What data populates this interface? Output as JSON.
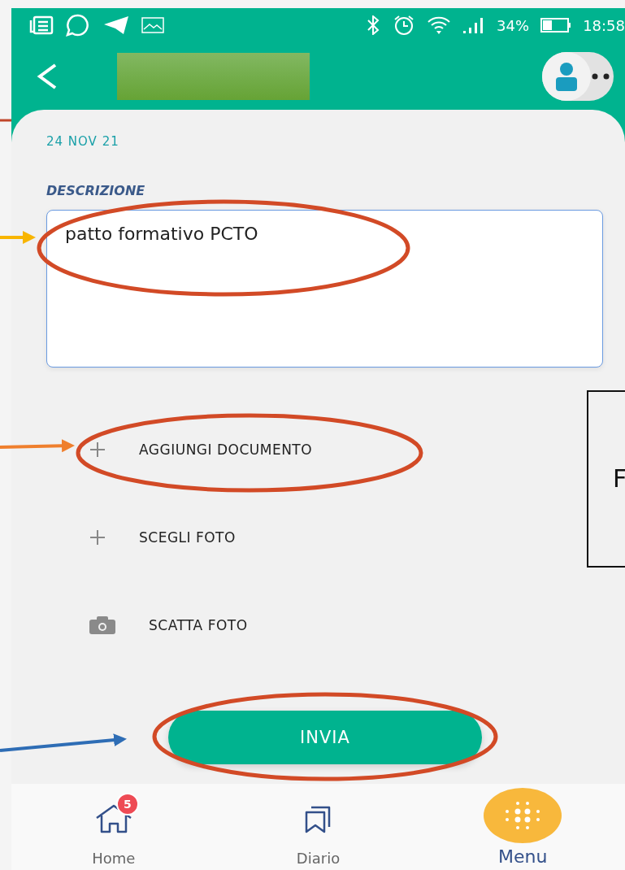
{
  "status_bar": {
    "battery": "34%",
    "time": "18:58"
  },
  "date": "24 NOV 21",
  "description": {
    "label": "DESCRIZIONE",
    "value": "patto formativo PCTO"
  },
  "actions": [
    {
      "kind": "add",
      "label": "AGGIUNGI DOCUMENTO"
    },
    {
      "kind": "add",
      "label": "SCEGLI FOTO"
    },
    {
      "kind": "camera",
      "label": "SCATTA FOTO"
    }
  ],
  "submit_button": "INVIA",
  "nav": [
    {
      "kind": "home",
      "label": "Home",
      "badge": "5",
      "selected": false
    },
    {
      "kind": "diary",
      "label": "Diario",
      "selected": false
    },
    {
      "kind": "menu",
      "label": "Menu",
      "selected": true
    }
  ],
  "callout": {
    "text": "F"
  }
}
